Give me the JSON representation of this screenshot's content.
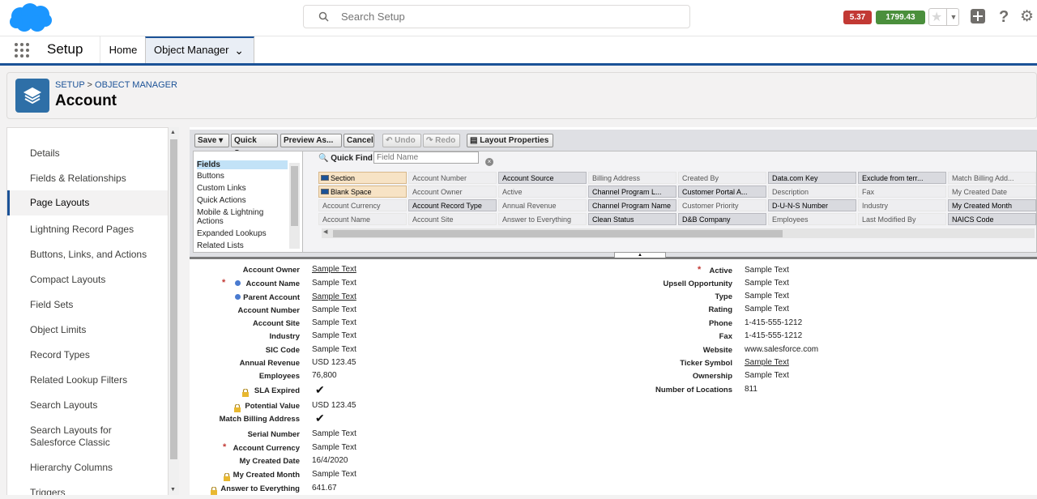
{
  "topbar": {
    "search_placeholder": "Search Setup",
    "timing_badge": "5.37 s",
    "size_badge": "1799.43 KB",
    "icons": [
      "salesforce-cloud-logo",
      "search-icon",
      "star-icon",
      "plus-icon",
      "help-icon",
      "gear-icon"
    ],
    "colors": {
      "timing": "#c23934",
      "size": "#4a8f3c",
      "brand": "#1b96ff"
    }
  },
  "nav": {
    "app_title": "Setup",
    "tabs": [
      {
        "label": "Home"
      },
      {
        "label": "Object Manager"
      }
    ]
  },
  "header": {
    "breadcrumb": [
      "SETUP",
      "OBJECT MANAGER"
    ],
    "breadcrumb_sep": ">",
    "title": "Account"
  },
  "sidebar": {
    "items": [
      {
        "label": "Details"
      },
      {
        "label": "Fields & Relationships"
      },
      {
        "label": "Page Layouts"
      },
      {
        "label": "Lightning Record Pages"
      },
      {
        "label": "Buttons, Links, and Actions"
      },
      {
        "label": "Compact Layouts"
      },
      {
        "label": "Field Sets"
      },
      {
        "label": "Object Limits"
      },
      {
        "label": "Record Types"
      },
      {
        "label": "Related Lookup Filters"
      },
      {
        "label": "Search Layouts"
      },
      {
        "label": "Search Layouts for Salesforce Classic"
      },
      {
        "label": "Hierarchy Columns"
      },
      {
        "label": "Triggers"
      }
    ],
    "active": "Page Layouts"
  },
  "toolbar": {
    "save": "Save",
    "quick_save": "Quick Save",
    "preview_as": "Preview As...",
    "cancel": "Cancel",
    "undo": "Undo",
    "redo": "Redo",
    "layout_properties": "Layout Properties"
  },
  "palette": {
    "categories": [
      "Fields",
      "Buttons",
      "Custom Links",
      "Quick Actions",
      "Mobile & Lightning Actions",
      "Expanded Lookups",
      "Related Lists"
    ],
    "quick_find_label": "Quick Find",
    "quick_find_placeholder": "Field Name",
    "columns": [
      [
        "Section",
        "Blank Space",
        "Account Currency",
        "Account Name"
      ],
      [
        "Account Number",
        "Account Owner",
        "Account Record Type",
        "Account Site"
      ],
      [
        "Account Source",
        "Active",
        "Annual Revenue",
        "Answer to Everything"
      ],
      [
        "Billing Address",
        "Channel Program L...",
        "Channel Program Name",
        "Clean Status"
      ],
      [
        "Created By",
        "Customer Portal A...",
        "Customer Priority",
        "D&B Company"
      ],
      [
        "Data.com Key",
        "Description",
        "D-U-N-S Number",
        "Employees"
      ],
      [
        "Exclude from terr...",
        "Fax",
        "Industry",
        "Last Modified By"
      ],
      [
        "Match Billing Add...",
        "My Created Date",
        "My Created Month",
        "NAICS Code"
      ]
    ]
  },
  "layout": {
    "left_fields": [
      {
        "label": "Account Owner",
        "value": "Sample Text",
        "underline": true
      },
      {
        "label": "Account Name",
        "value": "Sample Text",
        "required": true,
        "dot": true
      },
      {
        "label": "Parent Account",
        "value": "Sample Text",
        "underline": true,
        "dot": true
      },
      {
        "label": "Account Number",
        "value": "Sample Text"
      },
      {
        "label": "Account Site",
        "value": "Sample Text"
      },
      {
        "label": "Industry",
        "value": "Sample Text"
      },
      {
        "label": "SIC Code",
        "value": "Sample Text"
      },
      {
        "label": "Annual Revenue",
        "value": "USD 123.45"
      },
      {
        "label": "Employees",
        "value": "76,800"
      },
      {
        "label": "SLA Expired",
        "value": "✔",
        "lock": true,
        "check": true
      },
      {
        "label": "Potential Value",
        "value": "USD 123.45",
        "lock": true
      },
      {
        "label": "Match Billing Address",
        "value": "✔",
        "check": true
      },
      {
        "label": "Serial Number",
        "value": "Sample Text"
      },
      {
        "label": "Account Currency",
        "value": "Sample Text",
        "required": true
      },
      {
        "label": "My Created Date",
        "value": "16/4/2020"
      },
      {
        "label": "My Created Month",
        "value": "Sample Text",
        "lock": true
      },
      {
        "label": "Answer to Everything",
        "value": "641.67",
        "lock": true
      }
    ],
    "right_fields": [
      {
        "label": "Active",
        "value": "Sample Text",
        "required": true
      },
      {
        "label": "Upsell Opportunity",
        "value": "Sample Text"
      },
      {
        "label": "Type",
        "value": "Sample Text"
      },
      {
        "label": "Rating",
        "value": "Sample Text"
      },
      {
        "label": "Phone",
        "value": "1-415-555-1212"
      },
      {
        "label": "Fax",
        "value": "1-415-555-1212"
      },
      {
        "label": "Website",
        "value": "www.salesforce.com"
      },
      {
        "label": "Ticker Symbol",
        "value": "Sample Text",
        "underline": true
      },
      {
        "label": "Ownership",
        "value": "Sample Text"
      },
      {
        "label": "Number of Locations",
        "value": "811"
      }
    ]
  }
}
